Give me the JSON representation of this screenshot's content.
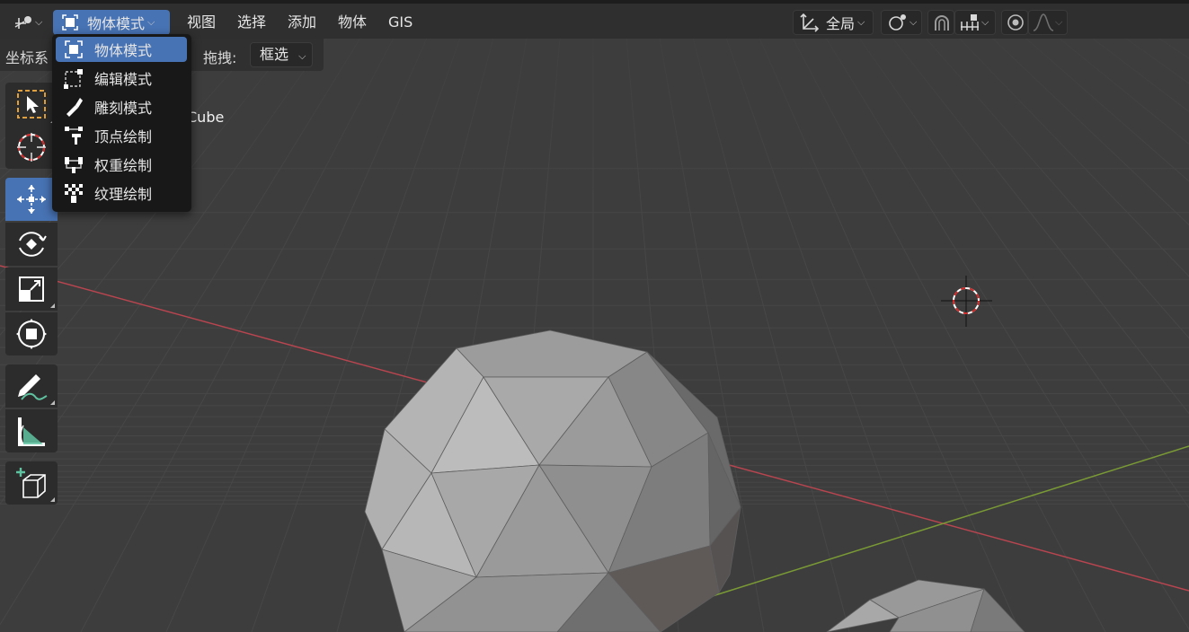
{
  "header": {
    "mode_selector_label": "物体模式",
    "menus": [
      "视图",
      "选择",
      "添加",
      "物体",
      "GIS"
    ],
    "transform_orientation_label": "全局"
  },
  "toolbar_strip": {
    "coordinate_label": "坐标系",
    "drag_label": "拖拽:",
    "drag_value": "框选"
  },
  "viewport": {
    "object_info": "Cube"
  },
  "mode_menu": {
    "items": [
      {
        "label": "物体模式",
        "icon": "object-mode-icon",
        "selected": true
      },
      {
        "label": "编辑模式",
        "icon": "edit-mode-icon",
        "selected": false
      },
      {
        "label": "雕刻模式",
        "icon": "sculpt-mode-icon",
        "selected": false
      },
      {
        "label": "顶点绘制",
        "icon": "vertex-paint-icon",
        "selected": false
      },
      {
        "label": "权重绘制",
        "icon": "weight-paint-icon",
        "selected": false
      },
      {
        "label": "纹理绘制",
        "icon": "texture-paint-icon",
        "selected": false
      }
    ]
  },
  "tools": [
    {
      "name": "select-box-tool",
      "icon": "select-box-icon",
      "active": false
    },
    {
      "name": "cursor-tool",
      "icon": "cursor-icon",
      "active": false
    },
    {
      "name": "move-tool",
      "icon": "move-icon",
      "active": true
    },
    {
      "name": "rotate-tool",
      "icon": "rotate-icon",
      "active": false
    },
    {
      "name": "scale-tool",
      "icon": "scale-icon",
      "active": false
    },
    {
      "name": "transform-tool",
      "icon": "transform-icon",
      "active": false
    },
    {
      "name": "annotate-tool",
      "icon": "annotate-icon",
      "active": false
    },
    {
      "name": "measure-tool",
      "icon": "measure-icon",
      "active": false
    },
    {
      "name": "add-cube-tool",
      "icon": "add-cube-icon",
      "active": false
    }
  ],
  "colors": {
    "accent": "#4772b3",
    "x_axis": "#b8454f",
    "y_axis": "#7a9a35",
    "background": "#3d3d3d"
  }
}
